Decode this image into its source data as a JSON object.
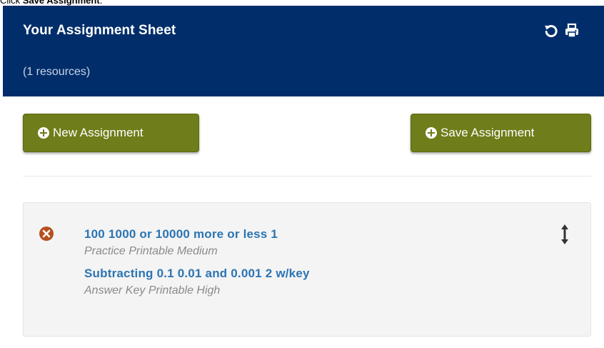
{
  "instruction": {
    "prefix": "Click ",
    "target": "Save Assignment",
    "suffix": "."
  },
  "header": {
    "title": "Your Assignment Sheet",
    "subtitle": "(1 resources)",
    "icons": [
      "reset-icon",
      "print-icon"
    ]
  },
  "actions": {
    "new_label": "New Assignment",
    "save_label": "Save Assignment"
  },
  "resources": [
    {
      "title": "100 1000 or 10000 more or less 1",
      "subtitle": "Practice Printable Medium"
    },
    {
      "title": "Subtracting 0.1 0.01 and 0.001 2 w/key",
      "subtitle": "Answer Key Printable High"
    }
  ],
  "colors": {
    "header_bg": "#012e6a",
    "button_bg": "#6f7d1a",
    "link": "#2b74b3",
    "remove": "#b5501e"
  }
}
